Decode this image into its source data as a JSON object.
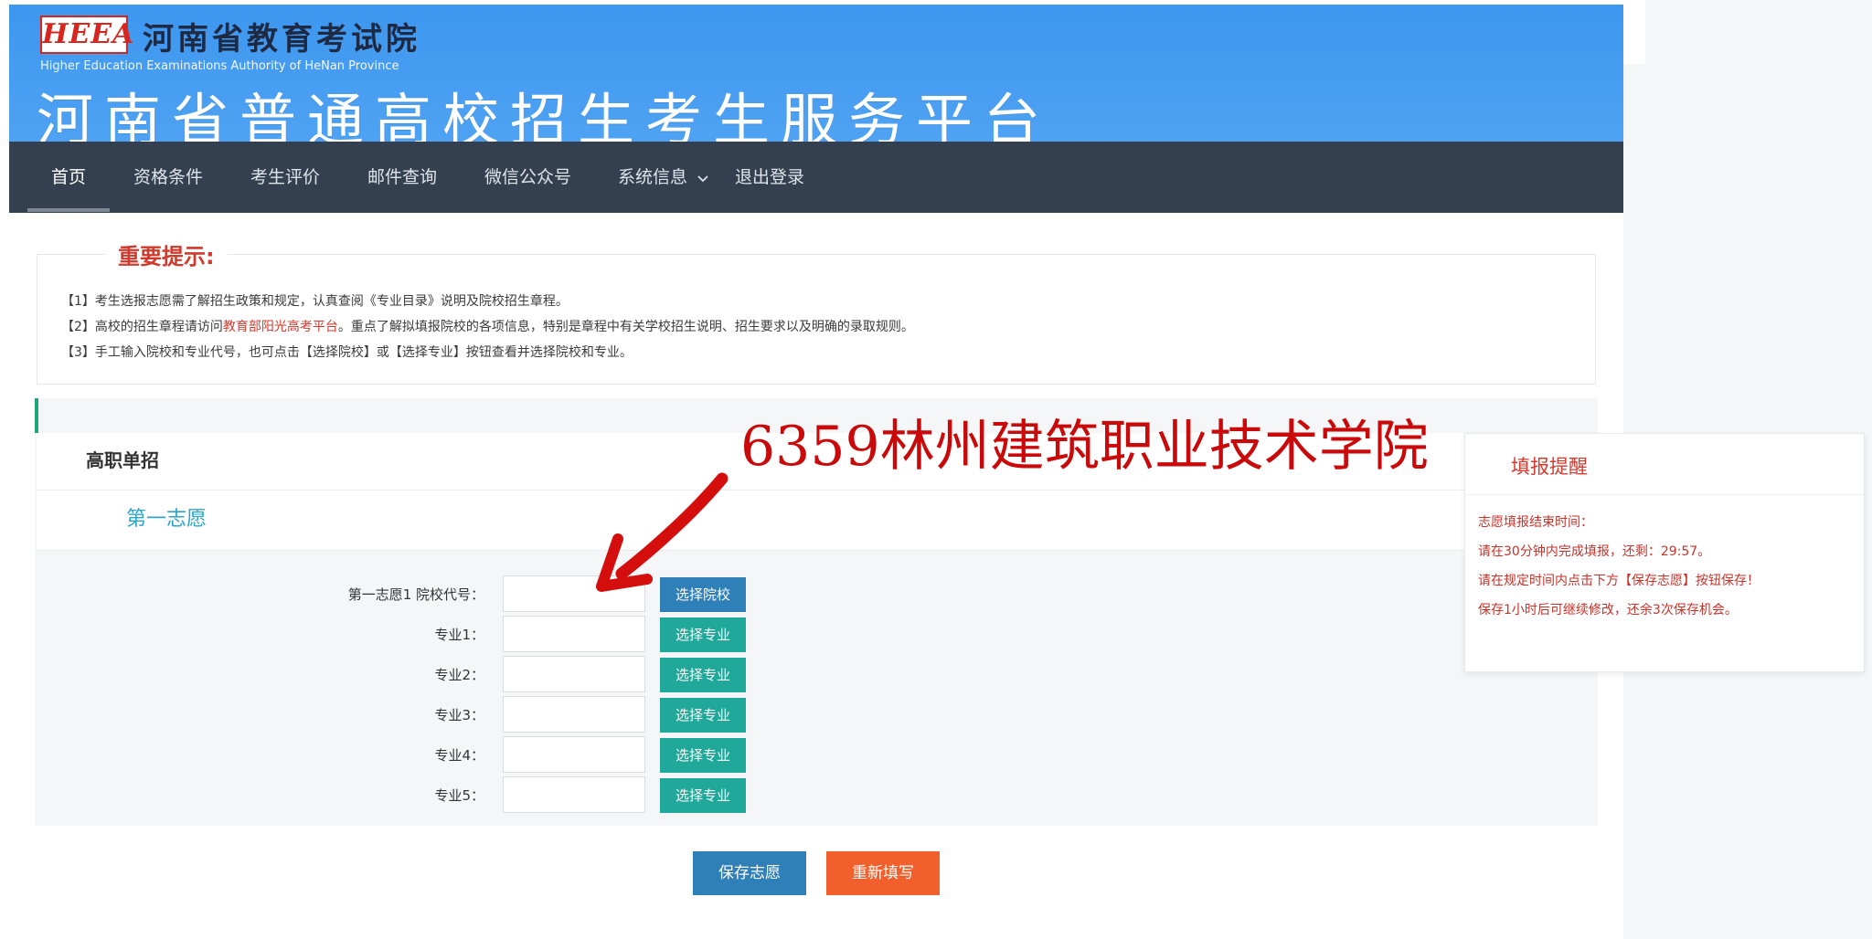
{
  "header": {
    "logo": "HEEA",
    "org_name": "河南省教育考试院",
    "org_en": "Higher Education Examinations Authority of HeNan Province",
    "platform_title": "河南省普通高校招生考生服务平台"
  },
  "nav": {
    "items": [
      {
        "label": "首页"
      },
      {
        "label": "资格条件"
      },
      {
        "label": "考生评价"
      },
      {
        "label": "邮件查询"
      },
      {
        "label": "微信公众号"
      },
      {
        "label": "系统信息"
      },
      {
        "label": "退出登录"
      }
    ],
    "dropdown_icon": "chevron-down-icon"
  },
  "notice": {
    "title": "重要提示:",
    "line1": "【1】考生选报志愿需了解招生政策和规定，认真查阅《专业目录》说明及院校招生章程。",
    "line2_prefix": "【2】高校的招生章程请访问",
    "line2_link": "教育部阳光高考平台",
    "line2_suffix": "。重点了解拟填报院校的各项信息，特别是章程中有关学校招生说明、招生要求以及明确的录取规则。",
    "line3": "【3】手工输入院校和专业代号，也可点击【选择院校】或【选择专业】按钮查看并选择院校和专业。"
  },
  "form": {
    "section_title": "高职单招",
    "volunteer_title": "第一志愿",
    "school_label": "第一志愿1 院校代号：",
    "school_button": "选择院校",
    "major_labels": [
      "专业1：",
      "专业2：",
      "专业3：",
      "专业4：",
      "专业5："
    ],
    "major_button": "选择专业",
    "save_button": "保存志愿",
    "reset_button": "重新填写"
  },
  "overlay": {
    "text": "6359林州建筑职业技术学院"
  },
  "reminder": {
    "title": "填报提醒",
    "line1": "志愿填报结束时间：",
    "line2": "请在30分钟内完成填报，还剩：29:57。",
    "line3": "请在规定时间内点击下方【保存志愿】按钮保存！",
    "line4": "保存1小时后可继续修改，还余3次保存机会。"
  },
  "colors": {
    "header_blue": "#3d97ef",
    "nav_bg": "#34404f",
    "accent_red": "#c9090a",
    "button_teal": "#20a89a",
    "button_blue": "#2f7fb8",
    "button_orange": "#f1602c"
  }
}
